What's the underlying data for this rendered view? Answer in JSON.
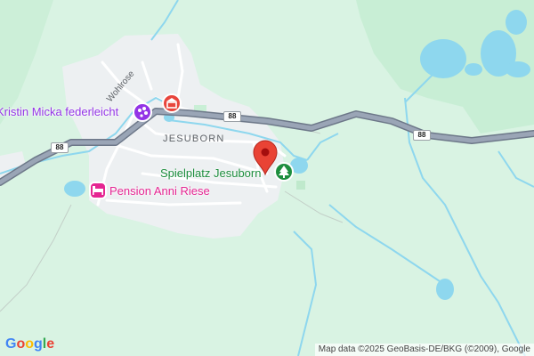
{
  "map": {
    "labels": {
      "place_1": "Kristin Micka federleicht",
      "place_2": "Spielplatz Jesuborn",
      "place_3": "Pension Anni Riese",
      "village": "JESUBORN",
      "street": "Wohlrose"
    },
    "road_shields": [
      "88",
      "88",
      "88"
    ],
    "attribution": "Map data ©2025 GeoBasis-DE/BKG (©2009), Google",
    "logo": [
      "G",
      "o",
      "o",
      "g",
      "l",
      "e"
    ],
    "colors": {
      "land": "#d9f3e3",
      "forest": "#c4ecd1",
      "built_up": "#edf0f2",
      "water": "#8ed7ee",
      "highway": "#8d99ae",
      "pin": "#e94335",
      "park_poi": "#1e8e3e",
      "shopping_poi": "#9334e6",
      "hotel_poi": "#e52592",
      "attraction_poi": "#e8453c"
    },
    "icons": [
      "pin-icon",
      "tree-icon",
      "palette-icon",
      "hotel-bed-icon",
      "attraction-icon"
    ]
  }
}
